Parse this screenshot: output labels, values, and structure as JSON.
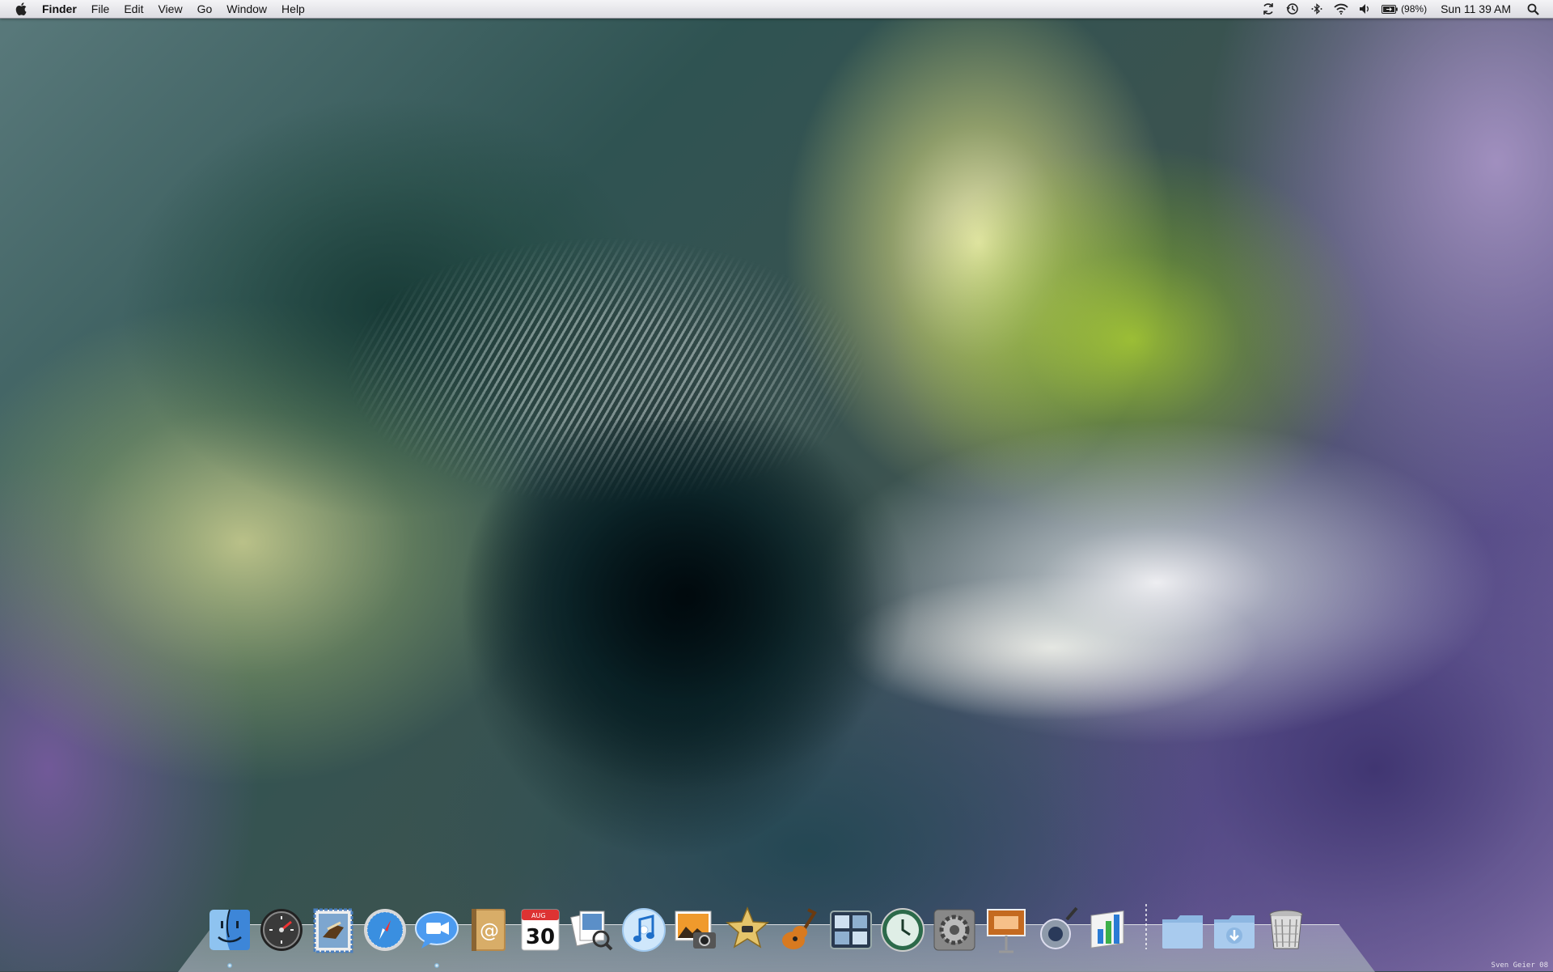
{
  "menubar": {
    "app_name": "Finder",
    "menus": [
      "File",
      "Edit",
      "View",
      "Go",
      "Window",
      "Help"
    ],
    "battery_percent": "(98%)",
    "clock": "Sun 11 39 AM"
  },
  "status_icons": [
    "sync-icon",
    "time-machine-icon",
    "bluetooth-icon",
    "wifi-icon",
    "volume-icon",
    "battery-icon",
    "spotlight-icon"
  ],
  "dock": {
    "apps": [
      {
        "name": "Finder",
        "icon": "finder-icon"
      },
      {
        "name": "Dashboard",
        "icon": "dashboard-icon"
      },
      {
        "name": "Mail",
        "icon": "mail-icon"
      },
      {
        "name": "Safari",
        "icon": "safari-icon"
      },
      {
        "name": "iChat",
        "icon": "ichat-icon"
      },
      {
        "name": "Address Book",
        "icon": "address-book-icon"
      },
      {
        "name": "iCal",
        "icon": "ical-icon"
      },
      {
        "name": "Preview",
        "icon": "preview-icon"
      },
      {
        "name": "iTunes",
        "icon": "itunes-icon"
      },
      {
        "name": "iPhoto",
        "icon": "iphoto-icon"
      },
      {
        "name": "iMovie",
        "icon": "imovie-icon"
      },
      {
        "name": "GarageBand",
        "icon": "garageband-icon"
      },
      {
        "name": "Spaces",
        "icon": "spaces-icon"
      },
      {
        "name": "Time Machine",
        "icon": "time-machine-app-icon"
      },
      {
        "name": "System Preferences",
        "icon": "system-preferences-icon"
      },
      {
        "name": "Keynote",
        "icon": "keynote-icon"
      },
      {
        "name": "Aperture",
        "icon": "aperture-icon"
      },
      {
        "name": "Numbers",
        "icon": "numbers-icon"
      }
    ],
    "calendar_month": "AUG",
    "calendar_day": "30",
    "stacks": [
      {
        "name": "Applications",
        "icon": "folder-icon"
      },
      {
        "name": "Downloads",
        "icon": "downloads-folder-icon"
      }
    ],
    "trash": {
      "name": "Trash",
      "icon": "trash-icon"
    }
  },
  "wallpaper_credit": "Sven Geier 08"
}
